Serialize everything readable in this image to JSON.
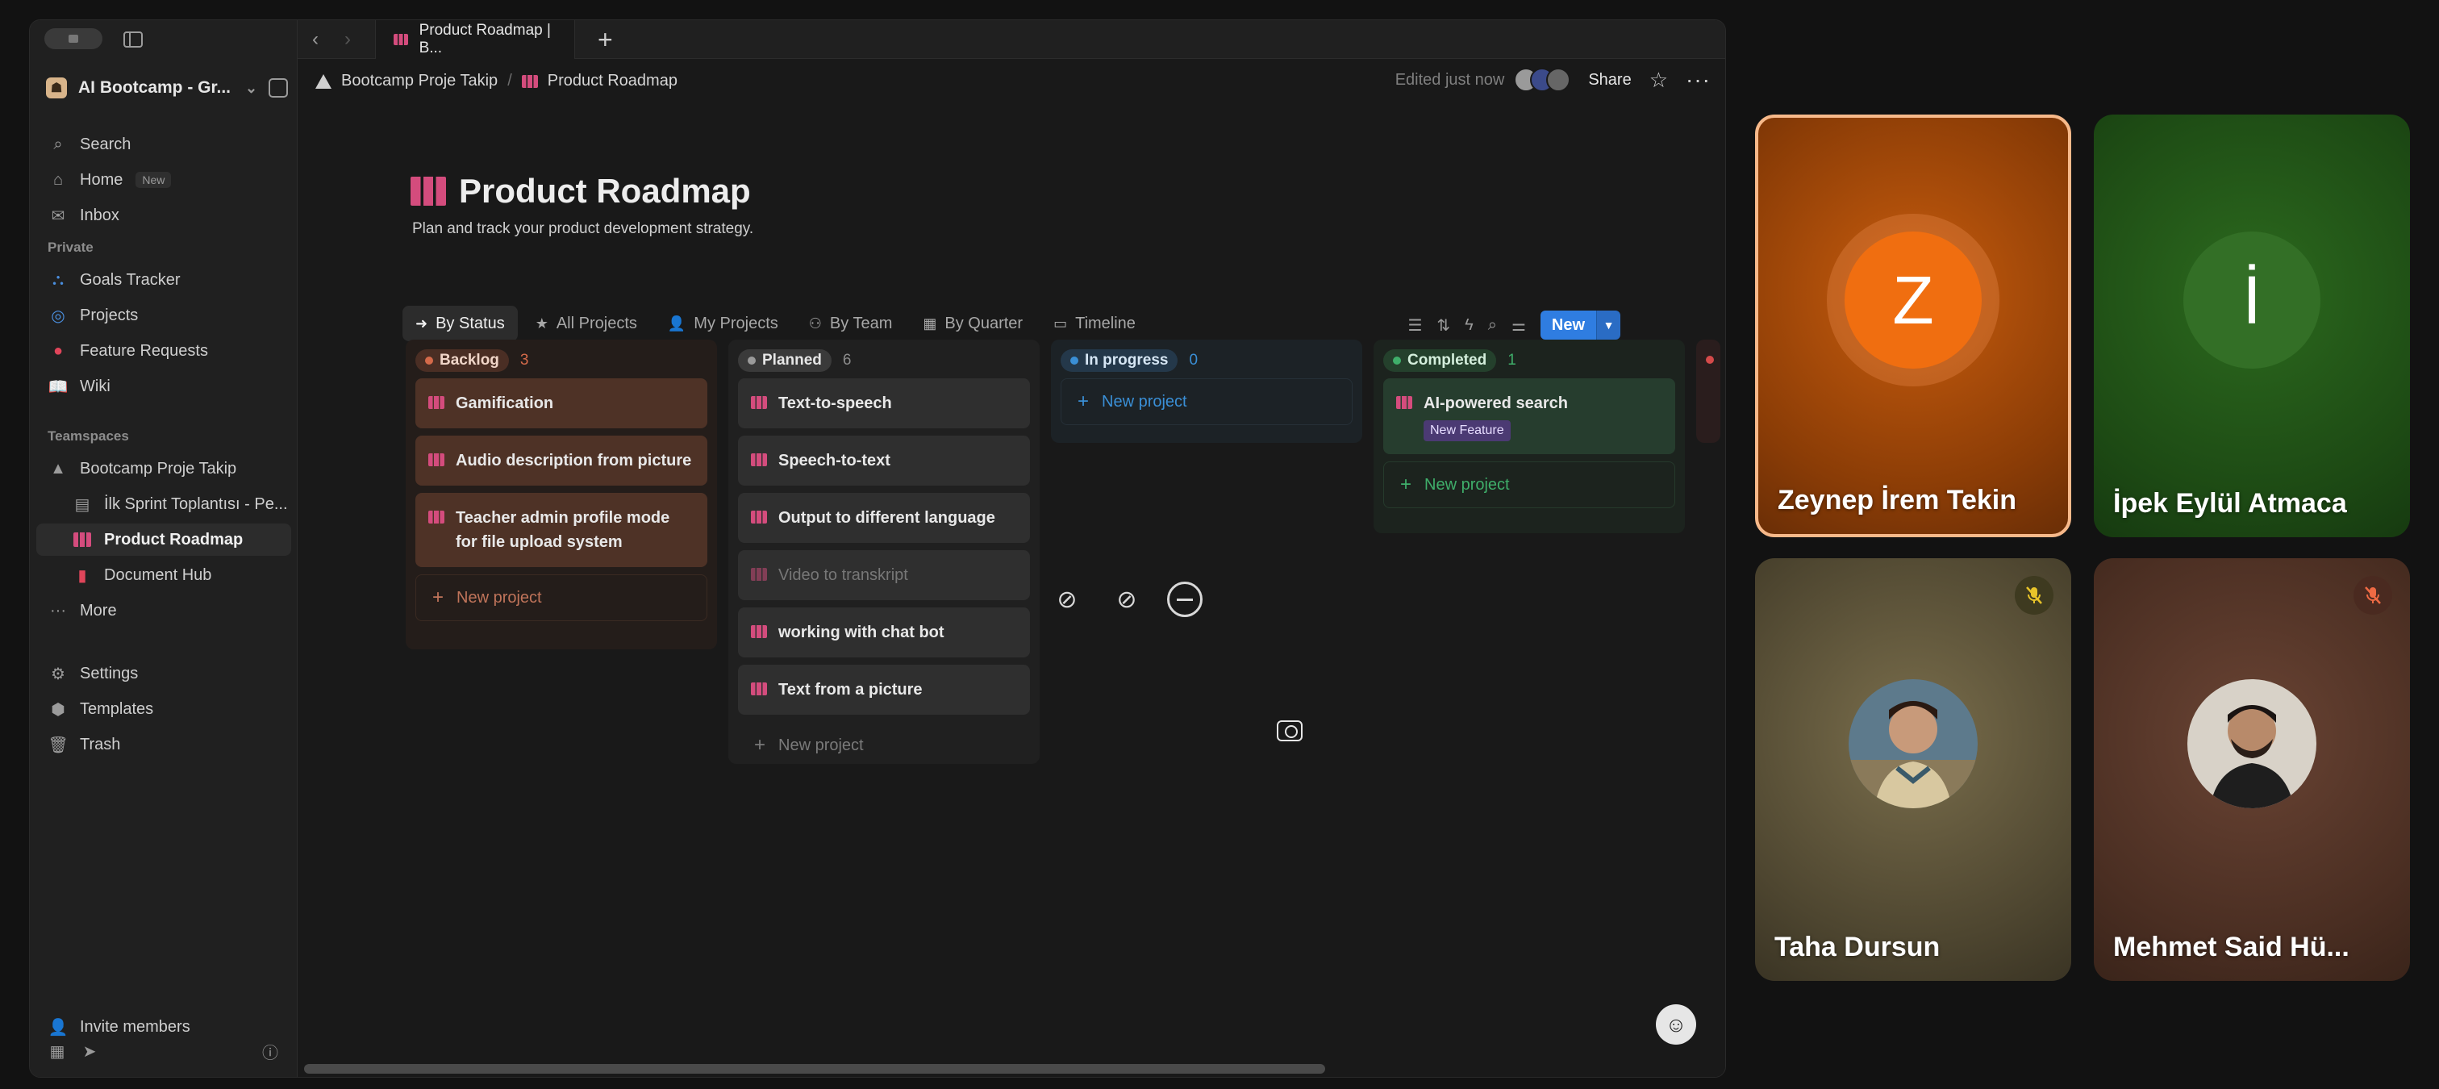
{
  "browser": {
    "tab_title": "Product Roadmap | B...",
    "add_tab": "+"
  },
  "sidebar": {
    "workspace_name": "AI Bootcamp - Gr...",
    "top_items": [
      {
        "label": "Search"
      },
      {
        "label": "Home",
        "badge": "New"
      },
      {
        "label": "Inbox"
      }
    ],
    "private_label": "Private",
    "private_items": [
      {
        "label": "Goals Tracker"
      },
      {
        "label": "Projects"
      },
      {
        "label": "Feature Requests"
      },
      {
        "label": "Wiki"
      }
    ],
    "teamspaces_label": "Teamspaces",
    "teamspace_items": [
      {
        "label": "Bootcamp Proje Takip"
      },
      {
        "label": "İlk Sprint Toplantısı - Pe..."
      },
      {
        "label": "Product Roadmap"
      },
      {
        "label": "Document Hub"
      },
      {
        "label": "More"
      }
    ],
    "settings_items": [
      {
        "label": "Settings"
      },
      {
        "label": "Templates"
      },
      {
        "label": "Trash"
      }
    ],
    "invite_label": "Invite members"
  },
  "topbar": {
    "breadcrumb": [
      "Bootcamp Proje Takip",
      "Product Roadmap"
    ],
    "edited": "Edited just now",
    "share": "Share"
  },
  "page": {
    "title": "Product Roadmap",
    "subtitle": "Plan and track your product development strategy."
  },
  "views": [
    {
      "label": "By Status",
      "icon": "arrow-icon"
    },
    {
      "label": "All Projects",
      "icon": "star-icon"
    },
    {
      "label": "My Projects",
      "icon": "person-icon"
    },
    {
      "label": "By Team",
      "icon": "team-icon"
    },
    {
      "label": "By Quarter",
      "icon": "calendar-icon"
    },
    {
      "label": "Timeline",
      "icon": "timeline-icon"
    }
  ],
  "new_button": "New",
  "board": {
    "new_project_label": "New project",
    "columns": [
      {
        "status": "Backlog",
        "count": "3",
        "cards": [
          {
            "title": "Gamification"
          },
          {
            "title": "Audio description from picture"
          },
          {
            "title": "Teacher admin profile mode for file upload system"
          }
        ]
      },
      {
        "status": "Planned",
        "count": "6",
        "cards": [
          {
            "title": "Text-to-speech"
          },
          {
            "title": "Speech-to-text"
          },
          {
            "title": "Output to different language"
          },
          {
            "title": "Video to transkript"
          },
          {
            "title": "working with chat bot"
          },
          {
            "title": "Text from a picture"
          }
        ]
      },
      {
        "status": "In progress",
        "count": "0",
        "cards": []
      },
      {
        "status": "Completed",
        "count": "1",
        "cards": [
          {
            "title": "AI-powered search",
            "tag": "New Feature"
          }
        ]
      }
    ]
  },
  "meet": {
    "participants": [
      {
        "name": "Zeynep İrem Tekin",
        "initial": "Z",
        "muted": false,
        "speaking": true,
        "color": "#e36a10"
      },
      {
        "name": "İpek Eylül Atmaca",
        "initial": "İ",
        "muted": false,
        "speaking": false,
        "color": "#2e6a22"
      },
      {
        "name": "Taha Dursun",
        "initial": "",
        "muted": true,
        "speaking": false,
        "color": "#6b6040"
      },
      {
        "name": "Mehmet Said Hü...",
        "initial": "",
        "muted": true,
        "speaking": false,
        "color": "#5a3a2a"
      }
    ]
  },
  "colors": {
    "accent": "#2f7de1",
    "backlog": "#d46a4a",
    "planned": "#9b9b9b",
    "in_progress": "#3a8fd6",
    "completed": "#3fae6a",
    "roadmap_icon": "#d44c7d"
  }
}
